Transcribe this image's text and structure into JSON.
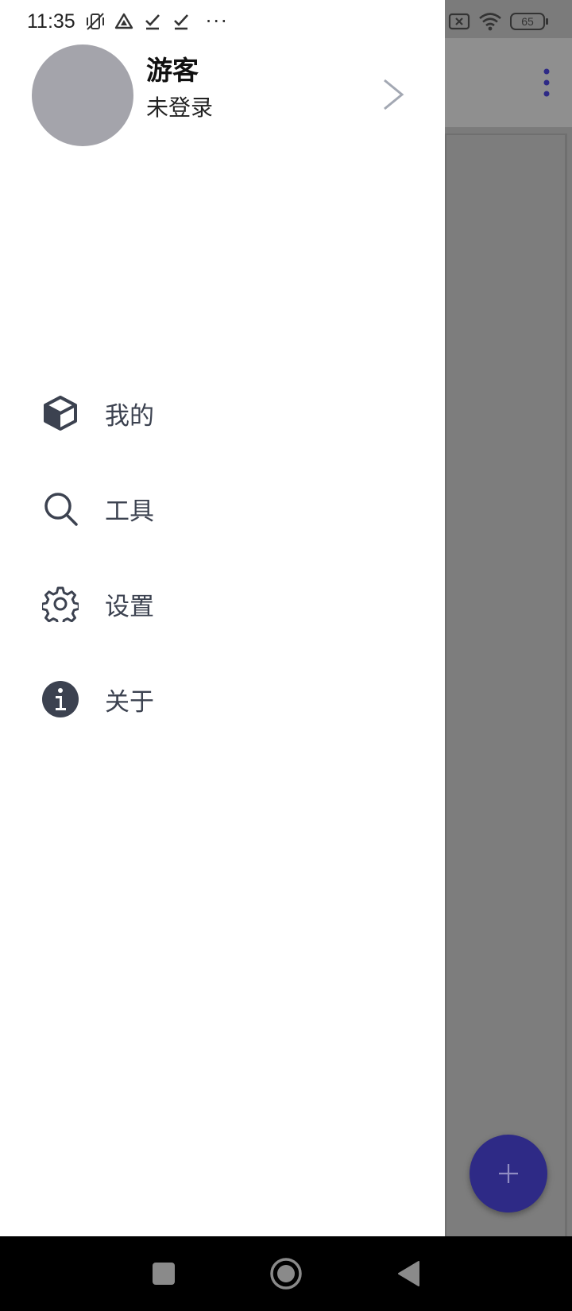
{
  "status_bar": {
    "time": "11:35",
    "battery": "65",
    "left_icons": [
      "vibrate-off-icon",
      "drive-icon",
      "check-icon",
      "check-icon"
    ],
    "more": "···",
    "right_icons": [
      "sim-off-icon",
      "wifi-icon",
      "battery-icon"
    ]
  },
  "drawer": {
    "profile": {
      "name": "游客",
      "status": "未登录"
    },
    "menu": [
      {
        "label": "我的",
        "icon": "cube-icon"
      },
      {
        "label": "工具",
        "icon": "search-icon"
      },
      {
        "label": "设置",
        "icon": "gear-icon"
      },
      {
        "label": "关于",
        "icon": "info-icon"
      }
    ]
  },
  "colors": {
    "accent": "#2e2a86",
    "icon": "#3c4250",
    "avatar": "#a4a4ab",
    "scrim": "#7b7b7b"
  },
  "fab": {
    "symbol": "+"
  }
}
